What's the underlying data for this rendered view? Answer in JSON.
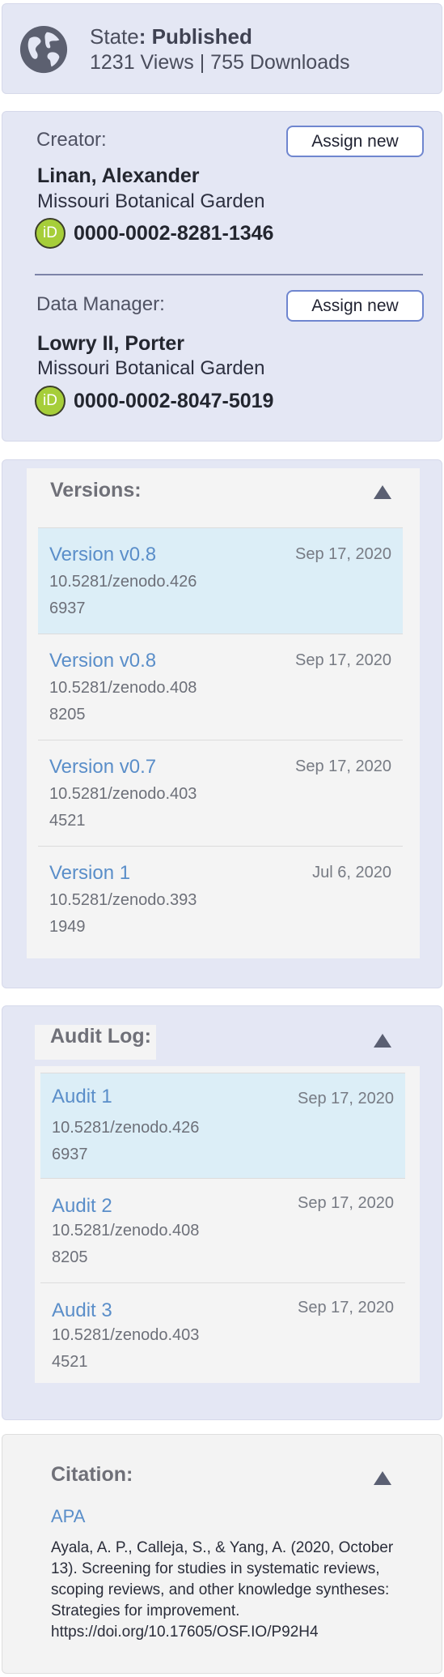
{
  "state": {
    "label": "State",
    "value": ": Published",
    "stats": "1231 Views | 755 Downloads",
    "icon": "globe-icon"
  },
  "creator": {
    "role": "Creator:",
    "assign_label": "Assign new",
    "name": "Linan, Alexander",
    "org": "Missouri Botanical Garden",
    "orcid_badge": "iD",
    "orcid": "0000-0002-8281-1346"
  },
  "data_manager": {
    "role": "Data Manager:",
    "assign_label": "Assign new",
    "name": "Lowry II, Porter",
    "org": "Missouri Botanical Garden",
    "orcid_badge": "iD",
    "orcid": "0000-0002-8047-5019"
  },
  "versions": {
    "title": "Versions:",
    "items": [
      {
        "label": "Version v0.8",
        "date": "Sep 17, 2020",
        "doi1": "10.5281/zenodo.426",
        "doi2": "6937",
        "active": true
      },
      {
        "label": "Version v0.8",
        "date": "Sep 17, 2020",
        "doi1": "10.5281/zenodo.408",
        "doi2": "8205",
        "active": false
      },
      {
        "label": "Version v0.7",
        "date": "Sep 17, 2020",
        "doi1": "10.5281/zenodo.403",
        "doi2": "4521",
        "active": false
      },
      {
        "label": "Version 1",
        "date": "Jul 6, 2020",
        "doi1": "10.5281/zenodo.393",
        "doi2": "1949",
        "active": false
      }
    ]
  },
  "audit": {
    "title": "Audit Log:",
    "items": [
      {
        "label": "Audit 1",
        "date": "Sep 17, 2020",
        "doi1": "10.5281/zenodo.426",
        "doi2": "6937",
        "active": true
      },
      {
        "label": "Audit 2",
        "date": "Sep 17, 2020",
        "doi1": "10.5281/zenodo.408",
        "doi2": "8205",
        "active": false
      },
      {
        "label": "Audit 3",
        "date": "Sep 17, 2020",
        "doi1": "10.5281/zenodo.403",
        "doi2": "4521",
        "active": false
      }
    ]
  },
  "citation": {
    "title": "Citation:",
    "style": "APA",
    "text": "Ayala, A. P., Calleja, S., & Yang, A. (2020, October 13). Screening for studies in systematic reviews, scoping reviews, and other knowledge syntheses: Strategies for improvement. https://doi.org/10.17605/OSF.IO/P92H4"
  },
  "colors": {
    "card_bg": "#e4e7f4",
    "link": "#5a8ec9",
    "active_row": "#dceef7",
    "orcid_green": "#a6ce39",
    "button_border": "#6f86cf"
  }
}
